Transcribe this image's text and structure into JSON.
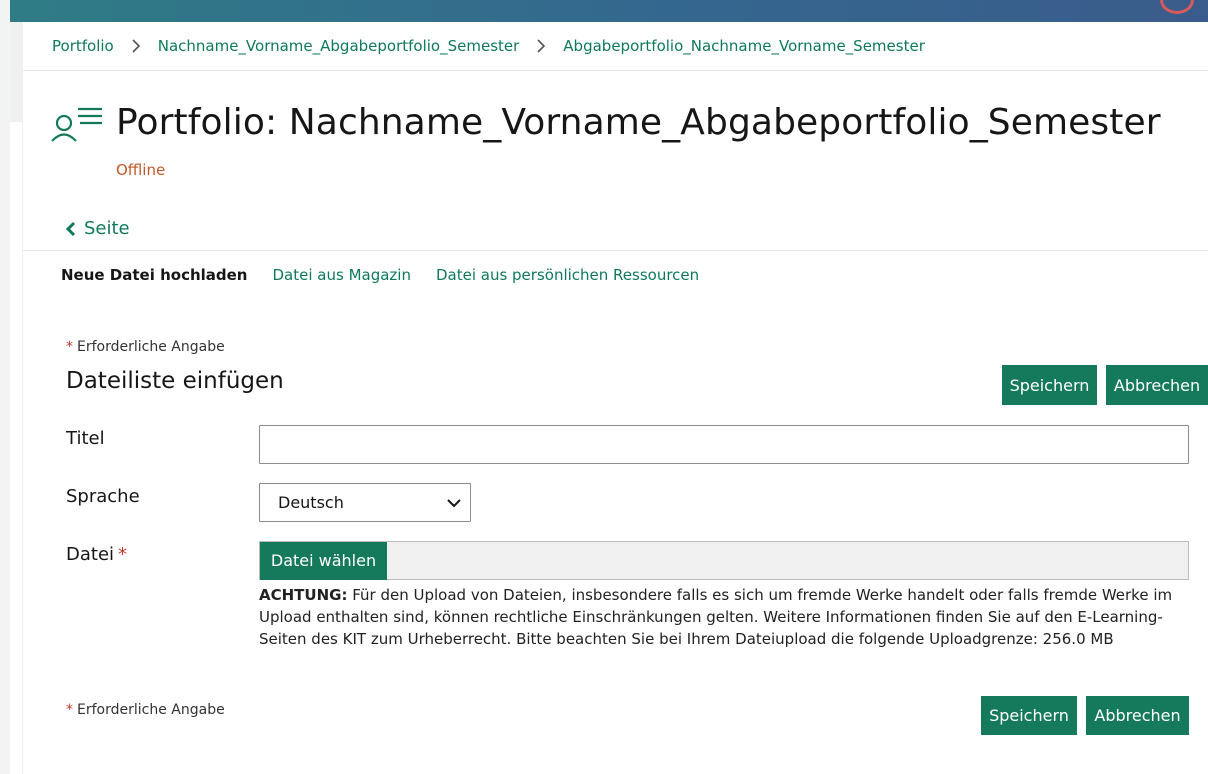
{
  "colors": {
    "accent": "#157a5b",
    "link": "#0e7a5a",
    "status_offline": "#c0582a",
    "required": "#c0392b"
  },
  "breadcrumb": [
    {
      "label": "Portfolio"
    },
    {
      "label": "Nachname_Vorname_Abgabeportfolio_Semester"
    },
    {
      "label": "Abgabeportfolio_Nachname_Vorname_Semester"
    }
  ],
  "header": {
    "icon": "portfolio-icon",
    "title": "Portfolio: Nachname_Vorname_Abgabeportfolio_Semester",
    "status": "Offline"
  },
  "back_link": {
    "icon": "chevron-left-icon",
    "label": "Seite"
  },
  "subtabs": [
    {
      "label": "Neue Datei hochladen",
      "active": true
    },
    {
      "label": "Datei aus Magazin",
      "active": false
    },
    {
      "label": "Datei aus persönlichen Ressourcen",
      "active": false
    }
  ],
  "form": {
    "required_marker": "*",
    "required_note": "Erforderliche Angabe",
    "title": "Dateiliste einfügen",
    "save_label": "Speichern",
    "cancel_label": "Abbrechen",
    "fields": {
      "titel": {
        "label": "Titel",
        "value": ""
      },
      "sprache": {
        "label": "Sprache",
        "value": "Deutsch",
        "icon": "chevron-down-icon"
      },
      "datei": {
        "label": "Datei",
        "required_marker": "*",
        "button_label": "Datei wählen"
      }
    },
    "help": {
      "bold": "ACHTUNG:",
      "text": " Für den Upload von Dateien, insbesondere falls es sich um fremde Werke handelt oder falls fremde Werke im Upload enthalten sind, können rechtliche Einschränkungen gelten. Weitere Informationen finden Sie auf den E-Learning-Seiten des KIT zum Urheberrecht. Bitte beachten Sie bei Ihrem Dateiupload die folgende Uploadgrenze: 256.0 MB"
    }
  }
}
